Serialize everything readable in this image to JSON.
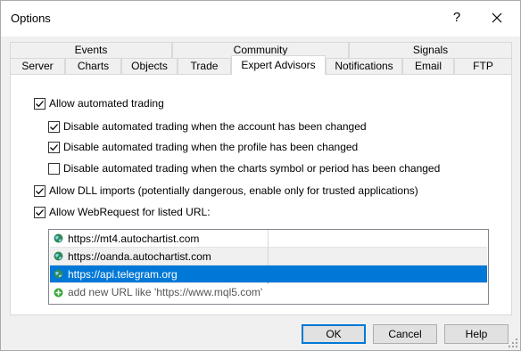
{
  "window": {
    "title": "Options",
    "help_label": "?"
  },
  "tabs_row1": [
    {
      "label": "Events"
    },
    {
      "label": "Community"
    },
    {
      "label": "Signals"
    }
  ],
  "tabs_row2": [
    {
      "label": "Server"
    },
    {
      "label": "Charts"
    },
    {
      "label": "Objects"
    },
    {
      "label": "Trade"
    },
    {
      "label": "Expert Advisors",
      "active": true
    },
    {
      "label": "Notifications"
    },
    {
      "label": "Email"
    },
    {
      "label": "FTP"
    }
  ],
  "options": {
    "allow_automated": {
      "label": "Allow automated trading",
      "checked": true
    },
    "disable_account": {
      "label": "Disable automated trading when the account has been changed",
      "checked": true
    },
    "disable_profile": {
      "label": "Disable automated trading when the profile has been changed",
      "checked": true
    },
    "disable_symbol": {
      "label": "Disable automated trading when the charts symbol or period has been changed",
      "checked": false
    },
    "allow_dll": {
      "label": "Allow DLL imports (potentially dangerous, enable only for trusted applications)",
      "checked": true
    },
    "allow_webrequest": {
      "label": "Allow WebRequest for listed URL:",
      "checked": true
    }
  },
  "url_list": {
    "items": [
      {
        "url": "https://mt4.autochartist.com",
        "selected": false
      },
      {
        "url": "https://oanda.autochartist.com",
        "selected": false
      },
      {
        "url": "https://api.telegram.org",
        "selected": true
      }
    ],
    "add_label": "add new URL like 'https://www.mql5.com'"
  },
  "buttons": {
    "ok": "OK",
    "cancel": "Cancel",
    "help": "Help"
  },
  "colors": {
    "selection": "#0078d7",
    "globe": "#2e8b57",
    "add_icon": "#3aa63a"
  }
}
